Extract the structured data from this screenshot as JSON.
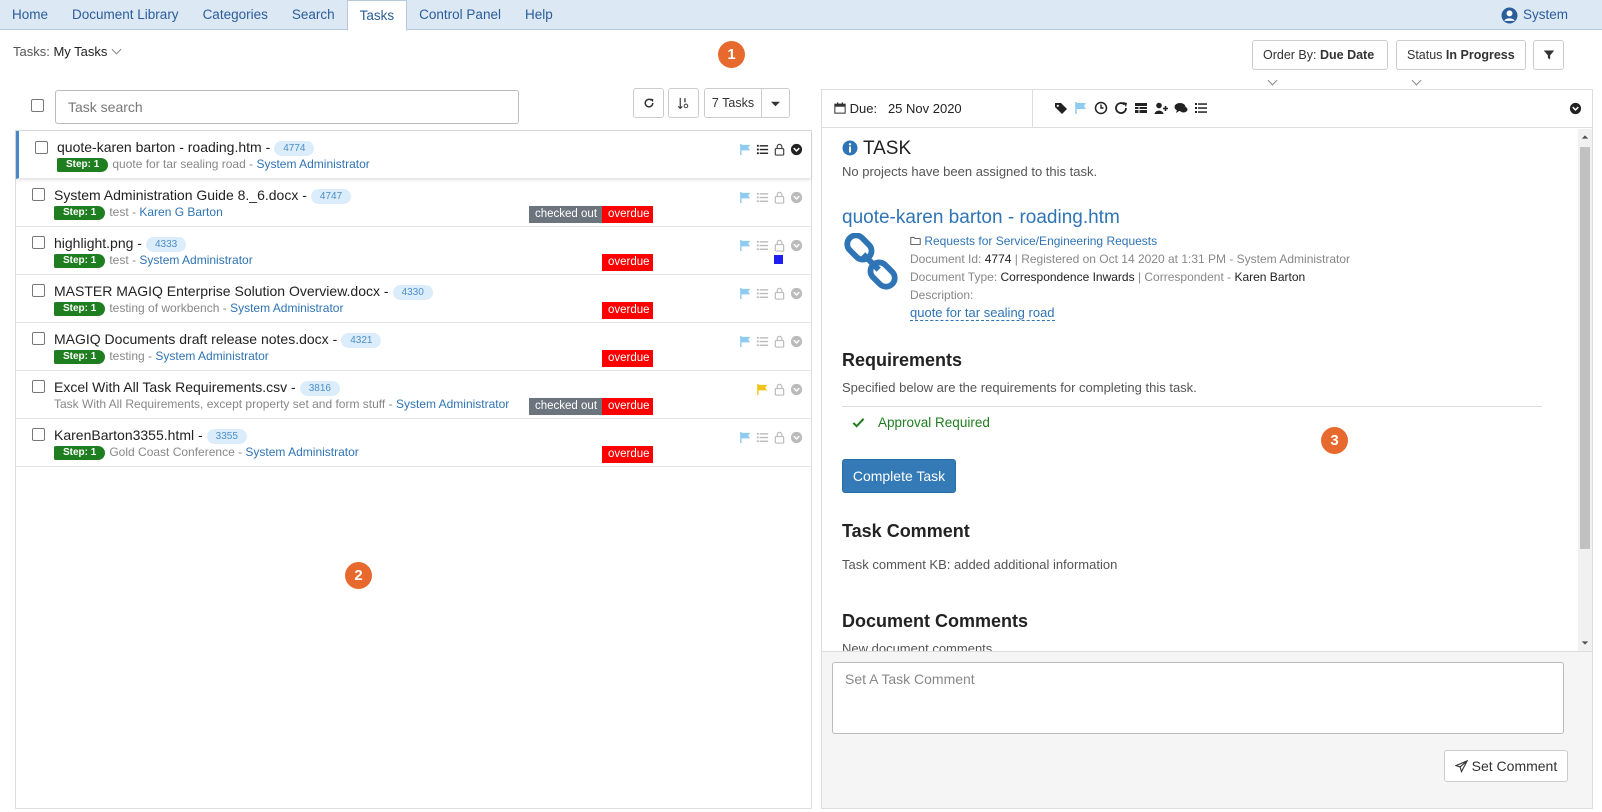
{
  "nav": {
    "items": [
      "Home",
      "Document Library",
      "Categories",
      "Search",
      "Tasks",
      "Control Panel",
      "Help"
    ],
    "active": "Tasks",
    "user": "System"
  },
  "toolbar": {
    "tasks_prefix": "Tasks:",
    "tasks_value": "My Tasks",
    "order_prefix": "Order By:",
    "order_value": "Due Date",
    "status_prefix": "Status",
    "status_value": "In Progress"
  },
  "list": {
    "search_placeholder": "Task search",
    "count_label": "7 Tasks",
    "rows": [
      {
        "title": "quote-karen barton - roading.htm -",
        "id": "4774",
        "step": "Step: 1",
        "desc": "quote for tar sealing road -",
        "user": "System Administrator",
        "checked_out": "",
        "overdue": ""
      },
      {
        "title": "System Administration Guide 8._6.docx -",
        "id": "4747",
        "step": "Step: 1",
        "desc": "test -",
        "user": "Karen G Barton",
        "checked_out": "checked out",
        "overdue": "overdue"
      },
      {
        "title": "highlight.png -",
        "id": "4333",
        "step": "Step: 1",
        "desc": "test -",
        "user": "System Administrator",
        "checked_out": "",
        "overdue": "overdue"
      },
      {
        "title": "MASTER MAGIQ Enterprise Solution Overview.docx -",
        "id": "4330",
        "step": "Step: 1",
        "desc": "testing of workbench -",
        "user": "System Administrator",
        "checked_out": "",
        "overdue": "overdue"
      },
      {
        "title": "MAGIQ Documents draft release notes.docx -",
        "id": "4321",
        "step": "Step: 1",
        "desc": "testing -",
        "user": "System Administrator",
        "checked_out": "",
        "overdue": "overdue"
      },
      {
        "title": "Excel With All Task Requirements.csv -",
        "id": "3816",
        "step": "",
        "desc": "Task With All Requirements, except property set and form stuff -",
        "user": "System Administrator",
        "checked_out": "checked out",
        "overdue": "overdue"
      },
      {
        "title": "KarenBarton3355.html -",
        "id": "3355",
        "step": "Step: 1",
        "desc": "Gold Coast Conference -",
        "user": "System Administrator",
        "checked_out": "",
        "overdue": "overdue"
      }
    ]
  },
  "detail": {
    "due_label": "Due:",
    "due_value": "25 Nov 2020",
    "task_heading": "TASK",
    "no_projects": "No projects have been assigned to this task.",
    "doc_title": "quote-karen barton - roading.htm",
    "folder": "Requests for Service/Engineering Requests",
    "doc_id_label": "Document Id:",
    "doc_id": "4774",
    "registered": "| Registered on Oct 14 2020 at 1:31 PM - System Administrator",
    "doc_type_label": "Document Type:",
    "doc_type": "Correspondence Inwards",
    "correspondent_label": "| Correspondent -",
    "correspondent": "Karen Barton",
    "description_label": "Description:",
    "description": "quote for tar sealing road",
    "requirements_heading": "Requirements",
    "requirements_text": "Specified below are the requirements for completing this task.",
    "approval": "Approval Required",
    "complete_button": "Complete Task",
    "task_comment_heading": "Task Comment",
    "task_comment": "Task comment KB: added additional information",
    "doc_comments_heading": "Document Comments",
    "doc_comments_text": "New document comments",
    "comment_placeholder": "Set A Task Comment",
    "set_comment_button": "Set Comment"
  },
  "callouts": [
    "1",
    "2",
    "3"
  ],
  "colors": {
    "callout": "#e8692d",
    "overdue": "#ff0000",
    "checked_out": "#6c757d",
    "step": "#1f7e1f",
    "link": "#2f74b5"
  }
}
